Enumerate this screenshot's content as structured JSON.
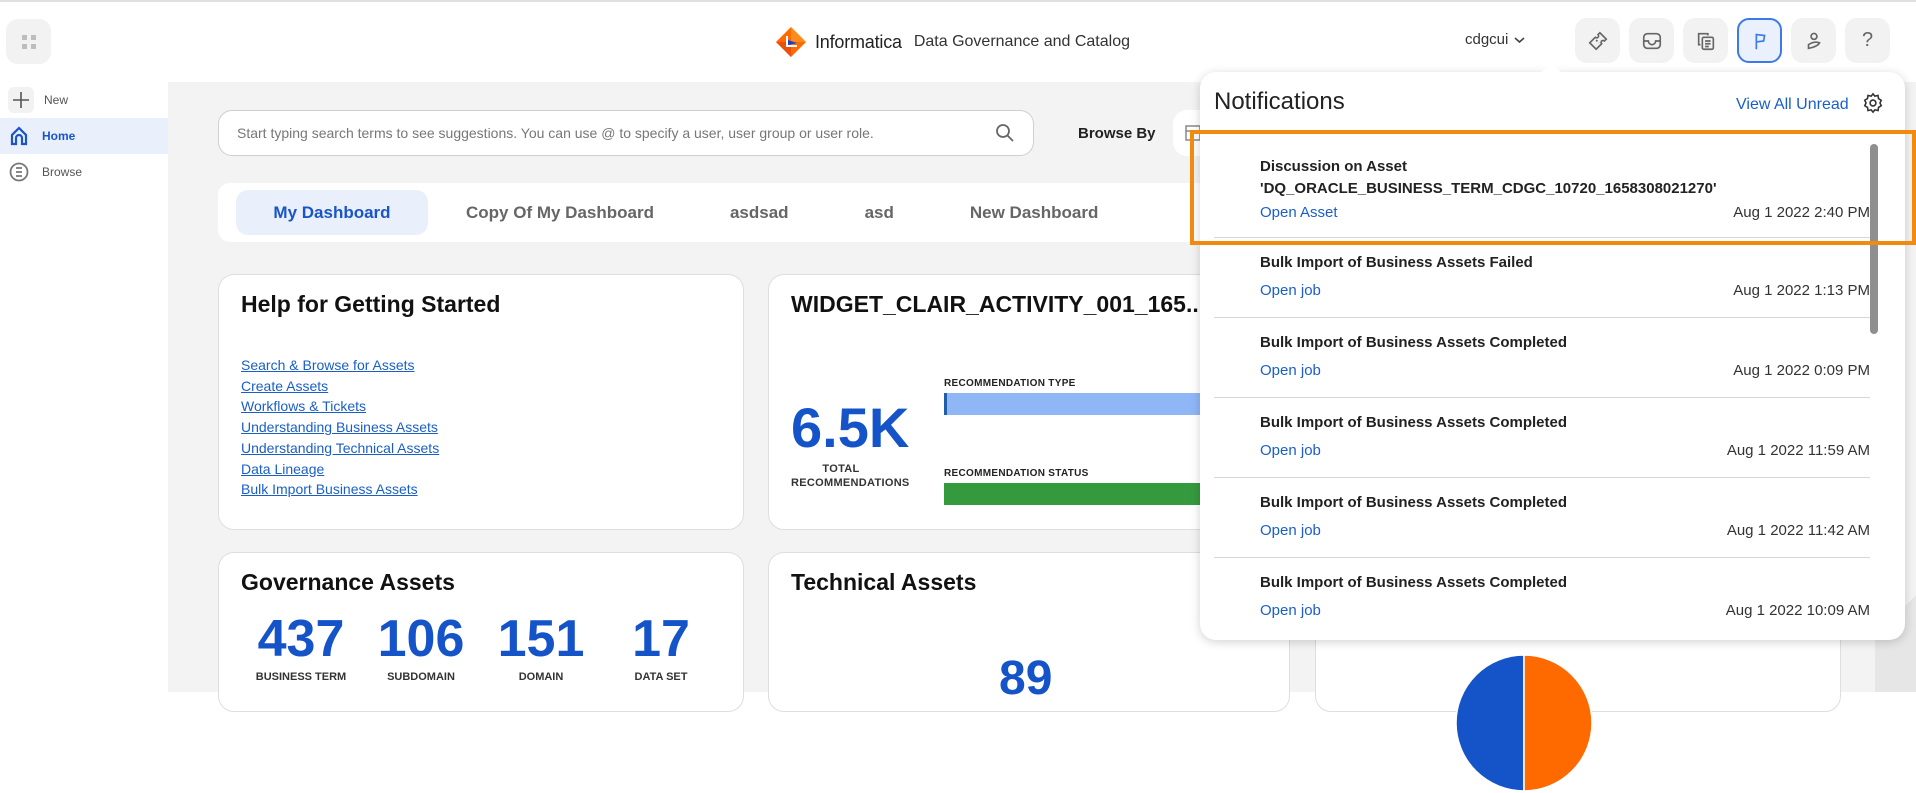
{
  "header": {
    "brand_name": "Informatica",
    "product_name": "Data Governance and Catalog",
    "org_selector": "cdgcui",
    "icons": [
      {
        "name": "ticket-icon",
        "active": false
      },
      {
        "name": "inbox-icon",
        "active": false
      },
      {
        "name": "copy-document-icon",
        "active": false
      },
      {
        "name": "flag-icon",
        "active": true
      },
      {
        "name": "user-icon",
        "active": false
      },
      {
        "name": "help-icon",
        "active": false
      }
    ],
    "help_glyph": "?"
  },
  "sidebar": {
    "items": [
      {
        "label": "New",
        "icon": "plus-icon"
      },
      {
        "label": "Home",
        "icon": "home-icon",
        "active": true
      },
      {
        "label": "Browse",
        "icon": "browse-icon"
      }
    ]
  },
  "search": {
    "placeholder": "Start typing search terms to see suggestions. You can use @ to specify a user, user group or user role.",
    "value": ""
  },
  "browse_by": "Browse By",
  "tabs": [
    {
      "label": "My Dashboard",
      "active": true
    },
    {
      "label": "Copy Of My Dashboard"
    },
    {
      "label": "asdsad"
    },
    {
      "label": "asd"
    },
    {
      "label": "New Dashboard"
    }
  ],
  "help_card": {
    "title": "Help for Getting Started",
    "links": [
      "Search & Browse for Assets",
      "Create Assets",
      "Workflows & Tickets",
      "Understanding Business Assets",
      "Understanding Technical Assets",
      "Data Lineage",
      "Bulk Import Business Assets"
    ]
  },
  "widget_card": {
    "title": "WIDGET_CLAIR_ACTIVITY_001_165...",
    "total_value": "6.5K",
    "total_label": "TOTAL RECOMMENDATIONS",
    "type_label": "RECOMMENDATION TYPE",
    "status_label": "RECOMMENDATION STATUS",
    "type_segments": [
      {
        "color": "#1f5fa8",
        "fraction": 0.01
      },
      {
        "color": "#8fb7f6",
        "fraction": 0.99
      }
    ],
    "status_segments": [
      {
        "color": "#359a3e",
        "fraction": 0.955
      },
      {
        "color": "#ffffff",
        "fraction": 0.004
      },
      {
        "color": "#f26a1b",
        "fraction": 0.006
      },
      {
        "color": "#ffffff",
        "fraction": 0.004
      },
      {
        "color": "#1aa0b8",
        "fraction": 0.031
      }
    ]
  },
  "governance_card": {
    "title": "Governance Assets",
    "stats": [
      {
        "value": "437",
        "label": "BUSINESS TERM"
      },
      {
        "value": "106",
        "label": "SUBDOMAIN"
      },
      {
        "value": "151",
        "label": "DOMAIN"
      },
      {
        "value": "17",
        "label": "DATA SET"
      }
    ]
  },
  "technical_card": {
    "title": "Technical Assets",
    "value": "89"
  },
  "third_card": {
    "pie": [
      {
        "color": "#1453c8",
        "fraction": 0.5
      },
      {
        "color": "#ff6a00",
        "fraction": 0.5
      }
    ]
  },
  "notifications": {
    "title": "Notifications",
    "view_all": "View All Unread",
    "items": [
      {
        "title": "Discussion on Asset 'DQ_ORACLE_BUSINESS_TERM_CDGC_10720_1658308021270'",
        "link": "Open Asset",
        "time": "Aug 1 2022 2:40 PM",
        "highlighted": true
      },
      {
        "title": "Bulk Import of Business Assets Failed",
        "link": "Open job",
        "time": "Aug 1 2022 1:13 PM"
      },
      {
        "title": "Bulk Import of Business Assets Completed",
        "link": "Open job",
        "time": "Aug 1 2022 0:09 PM"
      },
      {
        "title": "Bulk Import of Business Assets Completed",
        "link": "Open job",
        "time": "Aug 1 2022 11:59 AM"
      },
      {
        "title": "Bulk Import of Business Assets Completed",
        "link": "Open job",
        "time": "Aug 1 2022 11:42 AM"
      },
      {
        "title": "Bulk Import of Business Assets Completed",
        "link": "Open job",
        "time": "Aug 1 2022 10:09 AM"
      }
    ]
  },
  "colors": {
    "accent": "#1a55c8",
    "highlight_border": "#f18a0f",
    "link": "#1a5fc8"
  }
}
